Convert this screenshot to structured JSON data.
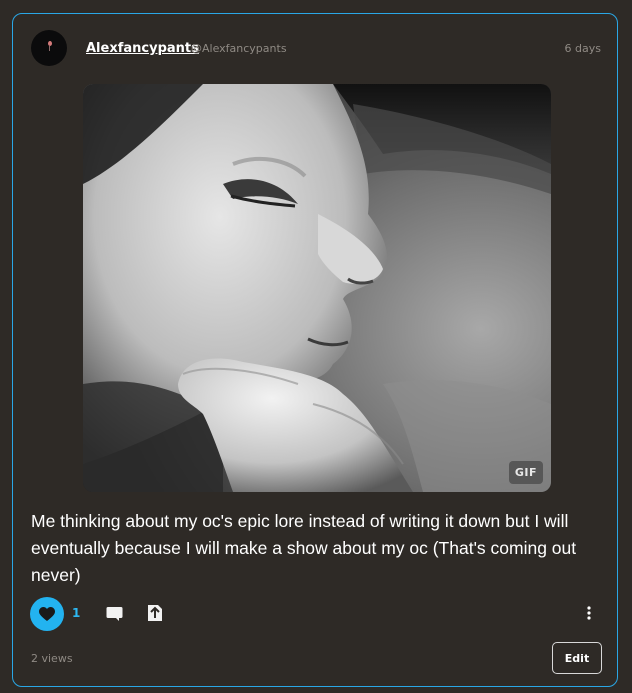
{
  "post": {
    "author": {
      "display_name": "Alexfancypants",
      "handle": "@Alexfancypants"
    },
    "timestamp": "6 days",
    "media": {
      "badge": "GIF",
      "alt_icon": "baby-photo"
    },
    "text": "Me thinking about my oc's epic lore instead of writing it down but I will eventually because I will make a show about my oc (That's coming out never)",
    "actions": {
      "like_count": "1",
      "like_icon": "heart-icon",
      "comment_icon": "comment-icon",
      "share_icon": "share-icon",
      "more_icon": "more-vertical-icon"
    },
    "views": "2 views",
    "edit_label": "Edit"
  },
  "colors": {
    "background": "#2e2a26",
    "card_border": "#2aa7e6",
    "accent": "#23b3f0",
    "text": "#ffffff",
    "muted": "#8f8a84"
  }
}
